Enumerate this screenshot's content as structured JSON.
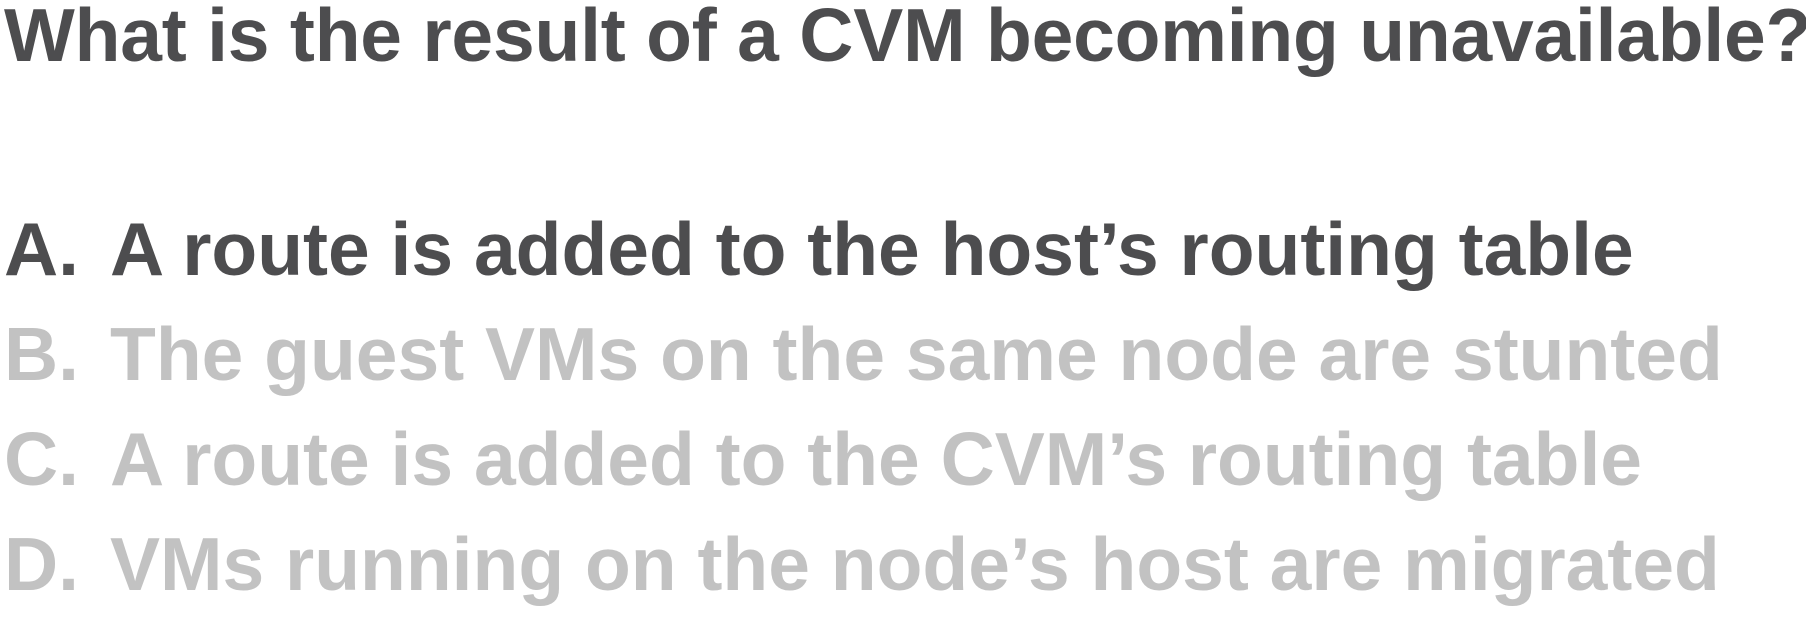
{
  "question": "What is the result of a CVM becoming unavailable?",
  "answers": [
    {
      "letter": "A.",
      "text": "A route is added to the host’s routing table",
      "state": "highlighted"
    },
    {
      "letter": "B.",
      "text": "The guest VMs on the same node are stunted",
      "state": "dimmed"
    },
    {
      "letter": "C.",
      "text": "A route is added to the CVM’s routing table",
      "state": "dimmed"
    },
    {
      "letter": "D.",
      "text": "VMs running on the node’s host are migrated",
      "state": "dimmed"
    }
  ],
  "colors": {
    "text_dark": "#4d4d4f",
    "text_dimmed": "#c2c2c2",
    "background": "#ffffff"
  }
}
